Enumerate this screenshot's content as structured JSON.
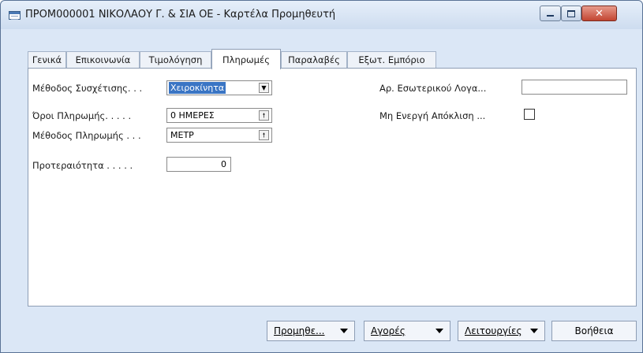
{
  "window": {
    "title": "ΠΡΟΜ000001 ΝΙΚΟΛΑΟΥ Γ. & ΣΙΑ ΟΕ - Καρτέλα Προμηθευτή",
    "close_glyph": "✕"
  },
  "tabs": [
    {
      "label": "Γενικά"
    },
    {
      "label": "Επικοινωνία"
    },
    {
      "label": "Τιμολόγηση"
    },
    {
      "label": "Πληρωμές",
      "active": true
    },
    {
      "label": "Παραλαβές"
    },
    {
      "label": "Εξωτ. Εμπόριο"
    }
  ],
  "form": {
    "matching_method": {
      "label": "Μέθοδος Συσχέτισης. . .",
      "value": "Χειροκίνητα",
      "dropdown_glyph": "▼"
    },
    "payment_terms": {
      "label": "Όροι Πληρωμής. . . . .",
      "value": "0 ΗΜΕΡΕΣ",
      "lookup_glyph": "🠕"
    },
    "payment_method": {
      "label": "Μέθοδος Πληρωμής . . .",
      "value": "ΜΕΤΡ",
      "lookup_glyph": "🠕"
    },
    "priority": {
      "label": "Προτεραιότητα . . . . .",
      "value": "0"
    },
    "internal_account": {
      "label": "Αρ. Εσωτερικού Λογα...",
      "value": ""
    },
    "inactive_deviation": {
      "label": "Μη Ενεργή Απόκλιση ...",
      "checked": false
    }
  },
  "buttons": {
    "supplier": "Προμηθε...",
    "purchases": "Αγορές",
    "functions": "Λειτουργίες",
    "help": "Βοήθεια"
  }
}
